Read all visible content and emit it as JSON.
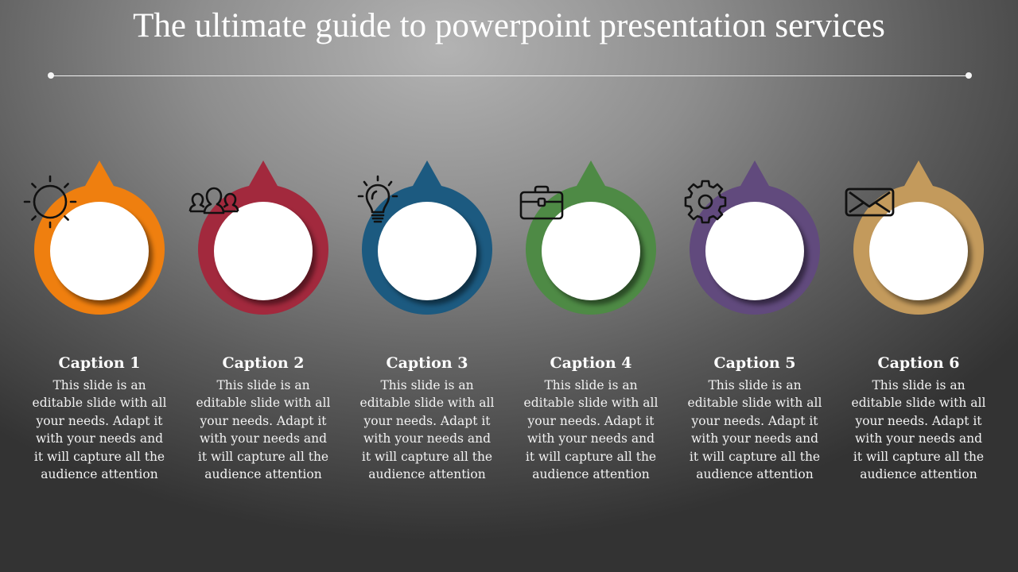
{
  "slide": {
    "title": "The ultimate guide to powerpoint presentation services"
  },
  "items": [
    {
      "caption": "Caption 1",
      "icon": "sun-icon",
      "color": "#ef7f0f",
      "body": "This slide is an editable slide with all your needs. Adapt it with your needs and it will capture all the audience attention"
    },
    {
      "caption": "Caption 2",
      "icon": "users-icon",
      "color": "#a2293d",
      "body": "This slide is an editable slide with all your needs. Adapt it with your needs and it will capture all the audience attention"
    },
    {
      "caption": "Caption 3",
      "icon": "lightbulb-icon",
      "color": "#1c5a80",
      "body": "This slide is an editable slide with all your needs. Adapt it with your needs and it will capture all the audience attention"
    },
    {
      "caption": "Caption 4",
      "icon": "briefcase-icon",
      "color": "#4e8a45",
      "body": "This slide is an editable slide with all your needs. Adapt it with your needs and it will capture all the audience attention"
    },
    {
      "caption": "Caption 5",
      "icon": "gear-icon",
      "color": "#614a7d",
      "body": "This slide is an editable slide with all your needs. Adapt it with your needs and it will capture all the audience attention"
    },
    {
      "caption": "Caption 6",
      "icon": "envelope-icon",
      "color": "#c39a5c",
      "body": "This slide is an editable slide with all your needs. Adapt it with your needs and it will capture all the audience attention"
    }
  ]
}
